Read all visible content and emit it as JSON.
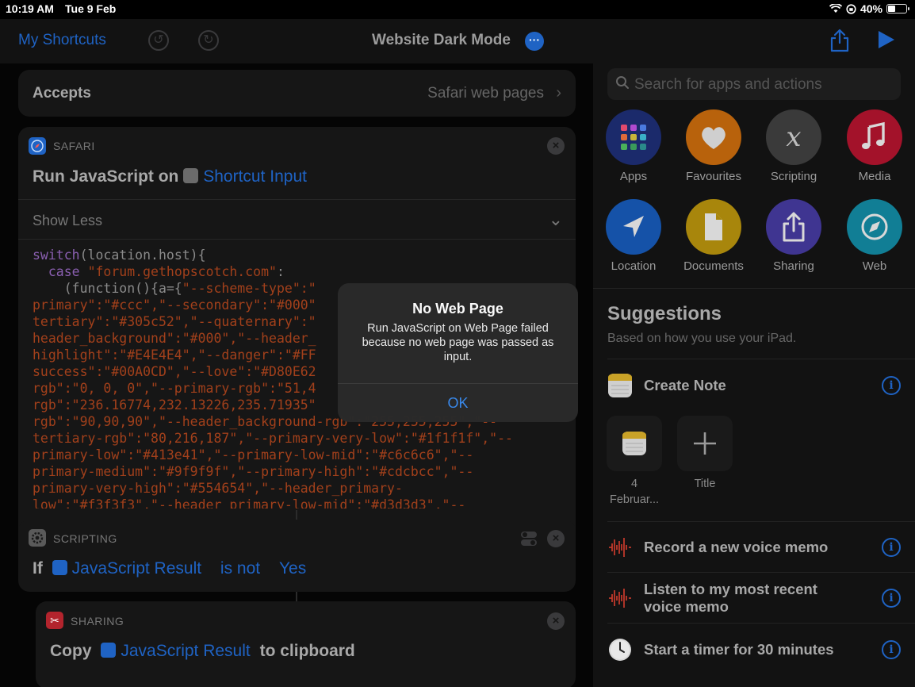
{
  "status_bar": {
    "time": "10:19 AM",
    "date": "Tue 9 Feb",
    "battery": "40%",
    "battery_level": 0.4
  },
  "nav": {
    "back_label": "My Shortcuts",
    "title": "Website Dark Mode"
  },
  "accepts": {
    "label": "Accepts",
    "value": "Safari web pages"
  },
  "safari_action": {
    "category": "SAFARI",
    "title_prefix": "Run JavaScript on",
    "input_token": "Shortcut Input",
    "toggle_label": "Show Less",
    "code_lines": [
      "switch(location.host){",
      "  case \"forum.gethopscotch.com\":",
      "    (function(){a={\"--scheme-type\":\"",
      "primary\":\"#ccc\",\"--secondary\":\"#000\"",
      "tertiary\":\"#305c52\",\"--quaternary\":\"",
      "header_background\":\"#000\",\"--header_",
      "highlight\":\"#E4E4E4\",\"--danger\":\"#FF",
      "success\":\"#00A0CD\",\"--love\":\"#D80E62",
      "rgb\":\"0, 0, 0\",\"--primary-rgb\":\"51,4",
      "rgb\":\"236.16774,232.13226,235.71935\"",
      "rgb\":\"90,90,90\",\"--header_background-rgb\":\"255,255,255\",\"--",
      "tertiary-rgb\":\"80,216,187\",\"--primary-very-low\":\"#1f1f1f\",\"--",
      "primary-low\":\"#413e41\",\"--primary-low-mid\":\"#c6c6c6\",\"--",
      "primary-medium\":\"#9f9f9f\",\"--primary-high\":\"#cdcbcc\",\"--",
      "primary-very-high\":\"#554654\",\"--header_primary-",
      "low\":\"#f3f3f3\",\"--header_primary-low-mid\":\"#d3d3d3\",\"--"
    ]
  },
  "scripting_action": {
    "category": "SCRIPTING",
    "if_label": "If",
    "variable": "JavaScript Result",
    "condition": "is not",
    "value": "Yes"
  },
  "sharing_action": {
    "category": "SHARING",
    "copy_label": "Copy",
    "variable": "JavaScript Result",
    "suffix": "to clipboard"
  },
  "sidebar": {
    "search_placeholder": "Search for apps and actions",
    "categories": [
      {
        "name": "Apps",
        "icon": "apps-grid-icon",
        "color": "#1b2a6b"
      },
      {
        "name": "Favourites",
        "icon": "heart-icon",
        "color": "#b8620c"
      },
      {
        "name": "Scripting",
        "icon": "scripting-x-icon",
        "color": "#3a3a3a"
      },
      {
        "name": "Media",
        "icon": "music-note-icon",
        "color": "#a3122a"
      },
      {
        "name": "Location",
        "icon": "location-arrow-icon",
        "color": "#1552a8"
      },
      {
        "name": "Documents",
        "icon": "document-icon",
        "color": "#a8860c"
      },
      {
        "name": "Sharing",
        "icon": "share-icon",
        "color": "#3f3591"
      },
      {
        "name": "Web",
        "icon": "compass-icon",
        "color": "#117e95"
      }
    ],
    "suggestions_title": "Suggestions",
    "suggestions_subtitle": "Based on how you use your iPad.",
    "create_note": {
      "label": "Create Note",
      "tiles": [
        {
          "line1": "4",
          "line2": "Februar..."
        },
        {
          "line1": "Title",
          "line2": ""
        }
      ]
    },
    "suggestion_rows": [
      {
        "label": "Record a new voice memo",
        "icon": "voice-memo-icon"
      },
      {
        "label": "Listen to my most recent voice memo",
        "icon": "voice-memo-icon"
      },
      {
        "label": "Start a timer for 30 minutes",
        "icon": "clock-icon"
      }
    ]
  },
  "alert": {
    "title": "No Web Page",
    "message": "Run JavaScript on Web Page failed because no web page was passed as input.",
    "ok_label": "OK"
  },
  "colors": {
    "accent": "#1f63c4",
    "background": "#000000",
    "card": "#161616",
    "code_string": "#a2401b",
    "code_keyword": "#8a5fb0"
  }
}
